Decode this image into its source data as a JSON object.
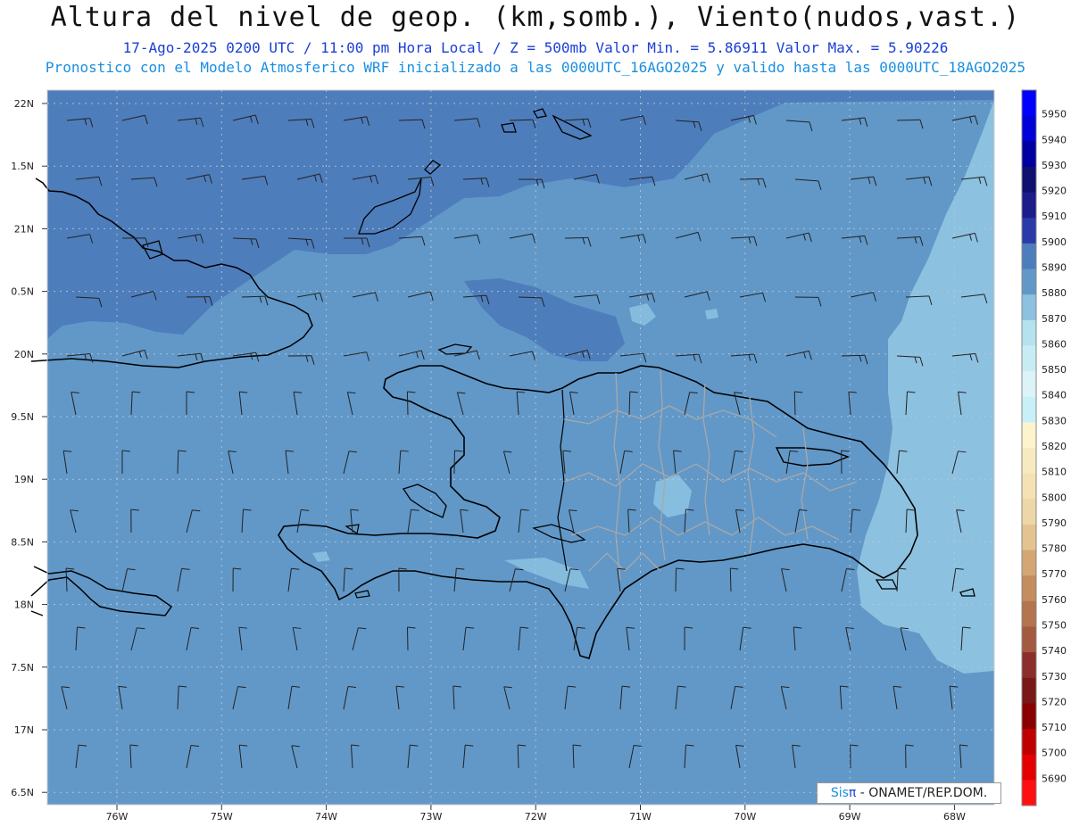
{
  "header": {
    "title": "Altura del nivel de geop. (km,somb.), Viento(nudos,vast.)",
    "subtitle_1": "17-Ago-2025  0200 UTC / 11:00 pm Hora Local / Z = 500mb    Valor Min. = 5.86911  Valor Max. = 5.90226",
    "subtitle_2": "Pronostico con el Modelo Atmosferico WRF inicializado a las 0000UTC_16AGO2025 y valido hasta las  0000UTC_18AGO2025"
  },
  "map": {
    "lat_ticks": [
      "22N",
      "1.5N",
      "21N",
      "0.5N",
      "20N",
      "9.5N",
      "19N",
      "8.5N",
      "18N",
      "7.5N",
      "17N",
      "6.5N"
    ],
    "lon_ticks": [
      "76W",
      "75W",
      "74W",
      "73W",
      "72W",
      "71W",
      "70W",
      "69W",
      "68W"
    ],
    "fill_colors": {
      "dark": "#4e7dbb",
      "mid": "#6198c8",
      "light": "#8cc1e0",
      "coast": "#000000",
      "provinces": "#a8a8a8"
    }
  },
  "colorbar": {
    "labels": [
      "5950",
      "5940",
      "5930",
      "5920",
      "5910",
      "5900",
      "5890",
      "5880",
      "5870",
      "5860",
      "5850",
      "5840",
      "5830",
      "5820",
      "5810",
      "5800",
      "5790",
      "5780",
      "5770",
      "5760",
      "5750",
      "5740",
      "5730",
      "5720",
      "5710",
      "5700",
      "5690"
    ],
    "colors": [
      "#0000ff",
      "#0000d8",
      "#0000a0",
      "#10106e",
      "#1c1c8a",
      "#2b3aa8",
      "#4e7dbb",
      "#6198c8",
      "#8cc1e0",
      "#b5e2ef",
      "#c8ecf4",
      "#dcf3f8",
      "#c8f0f8",
      "#fdf3cc",
      "#f8eac0",
      "#f4e2b4",
      "#eed7a6",
      "#e3c490",
      "#d3a673",
      "#c48d5e",
      "#b4744d",
      "#a35a40",
      "#8c2f2a",
      "#7a1818",
      "#8a0000",
      "#c00000",
      "#e40000",
      "#ff1010"
    ]
  },
  "credit": {
    "sis": "Sis",
    "pi": "π",
    "org": " - ONAMET/REP.DOM."
  }
}
